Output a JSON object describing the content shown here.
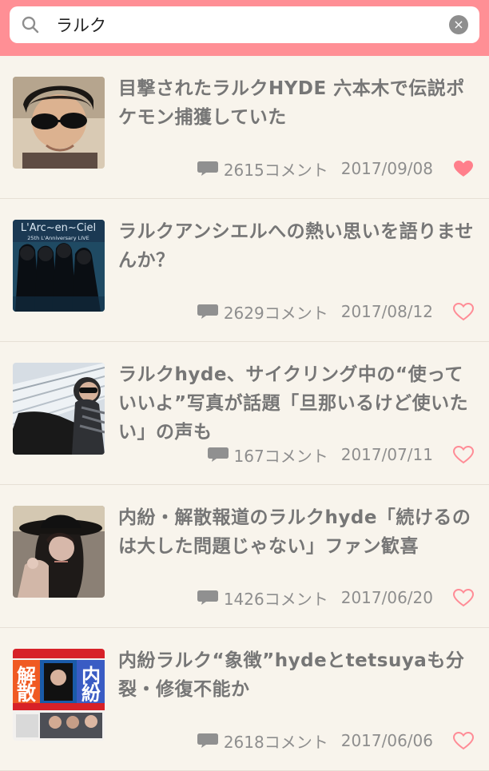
{
  "search": {
    "query": "ラルク"
  },
  "articles": [
    {
      "title": "目撃されたラルクHYDE 六本木で伝説ポケモン捕獲していた",
      "comments": "2615コメント",
      "date": "2017/09/08",
      "liked": true
    },
    {
      "title": "ラルクアンシエルへの熱い思いを語りませんか？",
      "comments": "2629コメント",
      "date": "2017/08/12",
      "liked": false
    },
    {
      "title": "ラルクhyde、サイクリング中の“使っていいよ”写真が話題「旦那いるけど使いたい」の声も",
      "comments": "167コメント",
      "date": "2017/07/11",
      "liked": false
    },
    {
      "title": "内紛・解散報道のラルクhyde「続けるのは大した問題じゃない」ファン歓喜",
      "comments": "1426コメント",
      "date": "2017/06/20",
      "liked": false
    },
    {
      "title": "内紛ラルク“象徴”hydeとtetsuyaも分裂・修復不能か",
      "comments": "2618コメント",
      "date": "2017/06/06",
      "liked": false
    }
  ],
  "thumbnails": {
    "article_2_text": "L'Arc~en~Ciel",
    "article_2_subtext": "25th L'Anniversary LIVE",
    "article_5_text_1": "解",
    "article_5_text_2": "散",
    "article_5_text_3": "内",
    "article_5_text_4": "紛"
  },
  "colors": {
    "header": "#ff8f95",
    "background": "#f8f4ec",
    "heart": "#ff7f8b",
    "text": "#767676"
  }
}
